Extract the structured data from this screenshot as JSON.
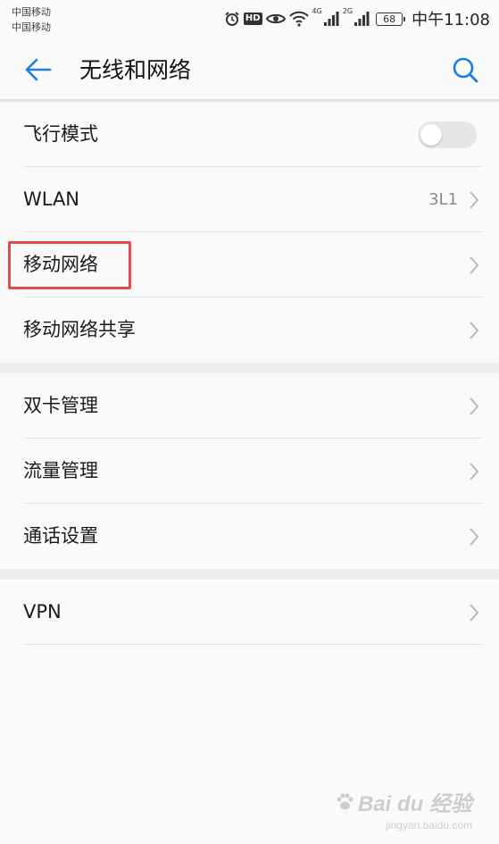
{
  "status_bar": {
    "carrier_1": "中国移动",
    "carrier_2": "中国移动",
    "hd": "HD",
    "net_1": "4G",
    "net_2": "2G",
    "battery": "68",
    "time": "中午11:08"
  },
  "header": {
    "title": "无线和网络",
    "back_icon": "arrow-left-icon",
    "search_icon": "search-icon",
    "accent_color": "#1a7de4"
  },
  "groups": [
    {
      "items": [
        {
          "label": "飞行模式",
          "type": "toggle",
          "on": false
        },
        {
          "label": "WLAN",
          "type": "nav",
          "value": "3L1"
        },
        {
          "label": "移动网络",
          "type": "nav",
          "highlighted": true
        },
        {
          "label": "移动网络共享",
          "type": "nav"
        }
      ]
    },
    {
      "items": [
        {
          "label": "双卡管理",
          "type": "nav"
        },
        {
          "label": "流量管理",
          "type": "nav"
        },
        {
          "label": "通话设置",
          "type": "nav"
        }
      ]
    },
    {
      "items": [
        {
          "label": "VPN",
          "type": "nav"
        }
      ]
    }
  ],
  "watermark": {
    "brand": "Bai du 经验",
    "url": "jingyan.baidu.com"
  }
}
